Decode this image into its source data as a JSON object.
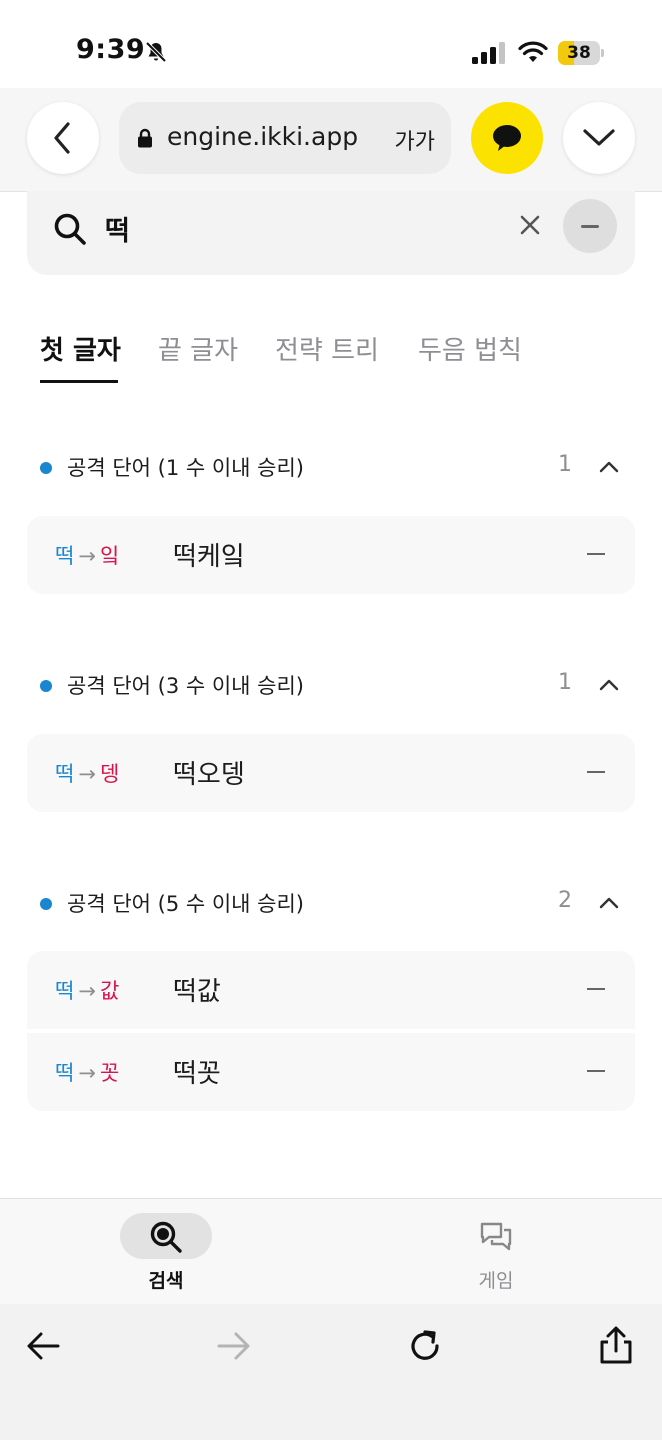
{
  "status_bar": {
    "time": "9:39",
    "battery": "38",
    "battery_level": 0.38,
    "icons": [
      "bell-slash-icon",
      "signal-icon",
      "wifi-icon",
      "battery-icon"
    ]
  },
  "browser": {
    "url": "engine.ikki.app",
    "text_size_label": "가가",
    "icons": [
      "chevron-left-icon",
      "lock-icon",
      "chat-bubble-icon",
      "chevron-down-icon"
    ],
    "chat_button_color": "#fbe200"
  },
  "search": {
    "value": "떡",
    "placeholder": "",
    "icons": [
      "search-icon",
      "clear-icon",
      "minus-icon"
    ]
  },
  "tabs": [
    {
      "label": "첫 글자",
      "active": true
    },
    {
      "label": "끝 글자",
      "active": false
    },
    {
      "label": "전략 트리",
      "active": false
    },
    {
      "label": "두음 법칙",
      "active": false
    }
  ],
  "sections": [
    {
      "title": "공격 단어 (1 수 이내 승리)",
      "count": "1",
      "words": [
        {
          "from": "떡",
          "arrow": "→",
          "to": "잌",
          "word": "떡케잌"
        }
      ]
    },
    {
      "title": "공격 단어 (3 수 이내 승리)",
      "count": "1",
      "words": [
        {
          "from": "떡",
          "arrow": "→",
          "to": "뎅",
          "word": "떡오뎅"
        }
      ]
    },
    {
      "title": "공격 단어 (5 수 이내 승리)",
      "count": "2",
      "words": [
        {
          "from": "떡",
          "arrow": "→",
          "to": "값",
          "word": "떡값"
        },
        {
          "from": "떡",
          "arrow": "→",
          "to": "꼿",
          "word": "떡꼿"
        }
      ]
    }
  ],
  "bottom_nav": {
    "items": [
      {
        "label": "검색",
        "icon": "search-icon",
        "active": true
      },
      {
        "label": "게임",
        "icon": "chat-bubbles-icon",
        "active": false
      }
    ]
  },
  "browser_toolbar": {
    "icons": [
      "arrow-left-icon",
      "arrow-right-icon",
      "reload-icon",
      "share-icon"
    ]
  },
  "colors": {
    "accent_blue": "#1a86d0",
    "accent_red": "#d8144c",
    "kakao_yellow": "#fbe200"
  }
}
